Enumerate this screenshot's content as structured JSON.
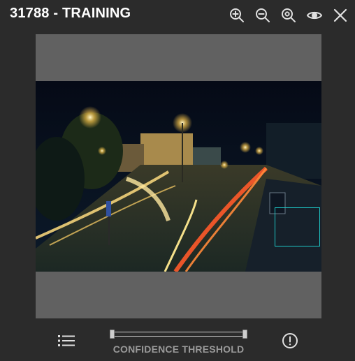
{
  "header": {
    "title": "31788 - TRAINING",
    "toolbar": [
      {
        "name": "zoom-in-button",
        "icon": "zoom-in-icon"
      },
      {
        "name": "zoom-out-button",
        "icon": "zoom-out-icon"
      },
      {
        "name": "zoom-reset-button",
        "icon": "zoom-fit-icon"
      },
      {
        "name": "visibility-button",
        "icon": "eye-icon"
      },
      {
        "name": "close-button",
        "icon": "close-icon"
      }
    ]
  },
  "viewer": {
    "image_description_icon": "night-street-photo",
    "bbox_color": "#1ec6c6"
  },
  "footer": {
    "list_icon": "list-icon",
    "slider_label": "CONFIDENCE THRESHOLD",
    "slider_range": [
      0,
      1
    ],
    "info_icon": "alert-circle-icon"
  },
  "colors": {
    "background": "#2b2b2b",
    "viewer_bg": "#616161",
    "icon": "#e0e0e0",
    "label": "#9a9a9a"
  }
}
